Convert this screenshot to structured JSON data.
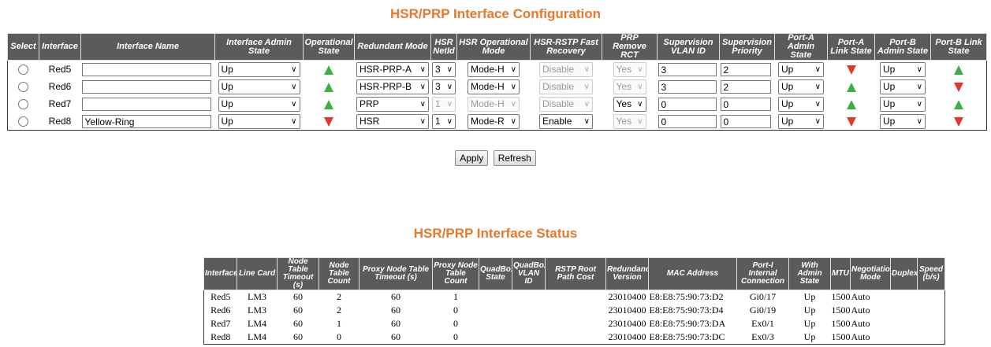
{
  "config": {
    "title": "HSR/PRP Interface Configuration",
    "headers": [
      "Select",
      "Interface",
      "Interface Name",
      "Interface Admin State",
      "Operational State",
      "Redundant Mode",
      "HSR NetId",
      "HSR Operational Mode",
      "HSR-RSTP Fast Recovery",
      "PRP Remove RCT",
      "Supervision VLAN ID",
      "Supervision Priority",
      "Port-A Admin State",
      "Port-A Link State",
      "Port-B Admin State",
      "Port-B Link State"
    ],
    "rows": [
      {
        "interface": "Red5",
        "name": "",
        "admin_state": "Up",
        "oper_state": "up",
        "redundant_mode": "HSR-PRP-A",
        "netid": "3",
        "netid_disabled": false,
        "hsr_mode": "Mode-H",
        "hsr_mode_disabled": false,
        "fast_recovery": "Disable",
        "fast_recovery_disabled": true,
        "remove_rct": "Yes",
        "remove_rct_disabled": true,
        "vlan_id": "3",
        "priority": "2",
        "porta_admin": "Up",
        "porta_link": "down",
        "portb_admin": "Up",
        "portb_link": "up"
      },
      {
        "interface": "Red6",
        "name": "",
        "admin_state": "Up",
        "oper_state": "up",
        "redundant_mode": "HSR-PRP-B",
        "netid": "3",
        "netid_disabled": false,
        "hsr_mode": "Mode-H",
        "hsr_mode_disabled": false,
        "fast_recovery": "Disable",
        "fast_recovery_disabled": true,
        "remove_rct": "Yes",
        "remove_rct_disabled": true,
        "vlan_id": "3",
        "priority": "2",
        "porta_admin": "Up",
        "porta_link": "up",
        "portb_admin": "Up",
        "portb_link": "down"
      },
      {
        "interface": "Red7",
        "name": "",
        "admin_state": "Up",
        "oper_state": "up",
        "redundant_mode": "PRP",
        "netid": "1",
        "netid_disabled": true,
        "hsr_mode": "Mode-H",
        "hsr_mode_disabled": true,
        "fast_recovery": "Disable",
        "fast_recovery_disabled": true,
        "remove_rct": "Yes",
        "remove_rct_disabled": false,
        "vlan_id": "0",
        "priority": "0",
        "porta_admin": "Up",
        "porta_link": "up",
        "portb_admin": "Up",
        "portb_link": "up"
      },
      {
        "interface": "Red8",
        "name": "Yellow-Ring",
        "admin_state": "Up",
        "oper_state": "down",
        "redundant_mode": "HSR",
        "netid": "1",
        "netid_disabled": false,
        "hsr_mode": "Mode-R",
        "hsr_mode_disabled": false,
        "fast_recovery": "Enable",
        "fast_recovery_disabled": false,
        "remove_rct": "Yes",
        "remove_rct_disabled": true,
        "vlan_id": "0",
        "priority": "0",
        "porta_admin": "Up",
        "porta_link": "down",
        "portb_admin": "Up",
        "portb_link": "down"
      }
    ],
    "apply_label": "Apply",
    "refresh_label": "Refresh"
  },
  "status": {
    "title": "HSR/PRP Interface Status",
    "headers": [
      "Interface",
      "Line Card",
      "Node Table Timeout (s)",
      "Node Table Count",
      "Proxy Node Table Timeout (s)",
      "Proxy Node Table Count",
      "QuadBox State",
      "QuadBox VLAN ID",
      "RSTP Root Path Cost",
      "Redundancy Version",
      "MAC Address",
      "Port-I Internal Connection",
      "With Admin State",
      "MTU",
      "Negotiation Mode",
      "Duplex",
      "Speed (b/s)"
    ],
    "rows": [
      [
        "Red5",
        "LM3",
        "60",
        "2",
        "60",
        "1",
        "",
        "",
        "",
        "23010400",
        "E8:E8:75:90:73:D2",
        "Gi0/17",
        "Up",
        "1500",
        "Auto",
        "",
        ""
      ],
      [
        "Red6",
        "LM3",
        "60",
        "2",
        "60",
        "0",
        "",
        "",
        "",
        "23010400",
        "E8:E8:75:90:73:D4",
        "Gi0/19",
        "Up",
        "1500",
        "Auto",
        "",
        ""
      ],
      [
        "Red7",
        "LM4",
        "60",
        "1",
        "60",
        "0",
        "",
        "",
        "",
        "23010400",
        "E8:E8:75:90:73:DA",
        "Ex0/1",
        "Up",
        "1500",
        "Auto",
        "",
        ""
      ],
      [
        "Red8",
        "LM4",
        "60",
        "0",
        "60",
        "0",
        "",
        "",
        "",
        "23010400",
        "E8:E8:75:90:73:DC",
        "Ex0/3",
        "Up",
        "1500",
        "Auto",
        "",
        ""
      ]
    ]
  },
  "colors": {
    "title": "#e8772b",
    "header_bg": "#5b5b5b",
    "link_up": "#3cb043",
    "link_down": "#e03a2e"
  },
  "icons": {
    "up": "green-up-triangle-icon",
    "down": "red-down-triangle-icon"
  }
}
